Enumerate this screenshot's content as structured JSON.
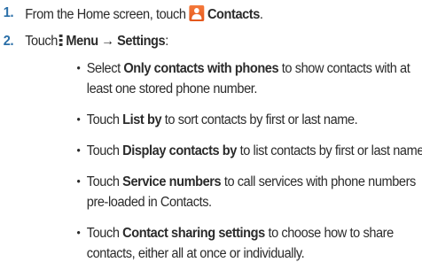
{
  "steps": [
    {
      "number": "1.",
      "pre": "From the Home screen, touch",
      "bold": "Contacts",
      "post": "."
    },
    {
      "number": "2.",
      "pre": "Touch",
      "bold": "Menu → Settings",
      "post": ":"
    }
  ],
  "bullets": [
    {
      "pre": "Select ",
      "bold": "Only contacts with phones",
      "post": " to show contacts with at",
      "cont": "least one stored phone number."
    },
    {
      "pre": "Touch ",
      "bold": "List by",
      "post": " to sort contacts by first or last name."
    },
    {
      "pre": "Touch ",
      "bold": "Display contacts by",
      "post": " to list contacts by first or last name."
    },
    {
      "pre": "Touch ",
      "bold": "Service numbers",
      "post": " to call services with phone numbers",
      "cont": "pre-loaded in Contacts."
    },
    {
      "pre": "Touch ",
      "bold": "Contact sharing settings",
      "post": " to choose how to share",
      "cont": "contacts, either all at once or individually."
    }
  ],
  "colors": {
    "step_number": "#2a6fa8",
    "contacts_icon": "#e4561b",
    "text": "#2b2b2b"
  },
  "icons": {
    "contacts": "contacts-app-icon",
    "menu": "menu-dots-icon"
  }
}
